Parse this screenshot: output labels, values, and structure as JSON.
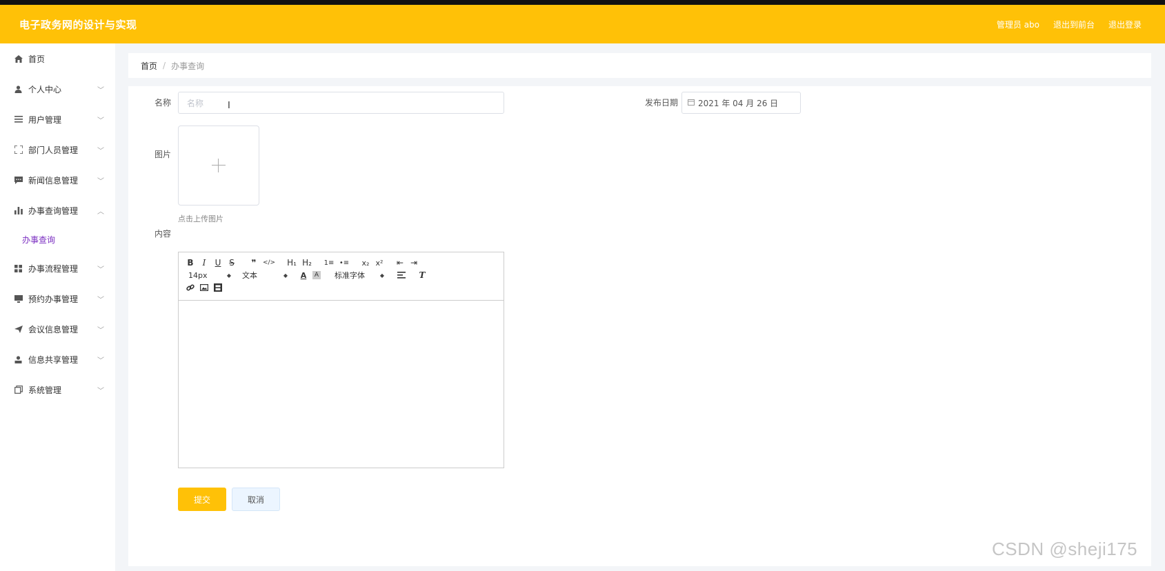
{
  "header": {
    "title": "电子政务网的设计与实现",
    "user_label": "管理员 abo",
    "back_to_front": "退出到前台",
    "logout": "退出登录",
    "bg_color": "#ffc107"
  },
  "sidebar": {
    "items": [
      {
        "label": "首页",
        "icon": "home-icon",
        "expandable": false
      },
      {
        "label": "个人中心",
        "icon": "user-icon",
        "expandable": true
      },
      {
        "label": "用户管理",
        "icon": "list-icon",
        "expandable": true
      },
      {
        "label": "部门人员管理",
        "icon": "expand-icon",
        "expandable": true
      },
      {
        "label": "新闻信息管理",
        "icon": "message-icon",
        "expandable": true
      },
      {
        "label": "办事查询管理",
        "icon": "bar-chart-icon",
        "expandable": true,
        "expanded": true
      },
      {
        "label": "办事流程管理",
        "icon": "grid-icon",
        "expandable": true
      },
      {
        "label": "预约办事管理",
        "icon": "monitor-icon",
        "expandable": true
      },
      {
        "label": "会议信息管理",
        "icon": "send-icon",
        "expandable": true
      },
      {
        "label": "信息共享管理",
        "icon": "person-icon",
        "expandable": true
      },
      {
        "label": "系统管理",
        "icon": "copy-icon",
        "expandable": true
      }
    ],
    "submenu": {
      "label": "办事查询",
      "color": "#7b2fc1"
    }
  },
  "breadcrumb": {
    "home": "首页",
    "separator": "/",
    "current": "办事查询"
  },
  "form": {
    "name_label": "名称",
    "name_placeholder": "名称",
    "date_label": "发布日期",
    "date_value": "2021 年 04 月 26 日",
    "image_label": "图片",
    "upload_tip": "点击上传图片",
    "content_label": "内容",
    "submit": "提交",
    "cancel": "取消"
  },
  "editor": {
    "size_select": "14px",
    "format_select": "文本",
    "font_select": "标准字体",
    "row1": [
      {
        "label": "B",
        "icon": "bold-icon"
      },
      {
        "label": "I",
        "icon": "italic-icon"
      },
      {
        "label": "U",
        "icon": "underline-icon"
      },
      {
        "label": "S",
        "icon": "strikethrough-icon"
      },
      {
        "label": "❞",
        "icon": "blockquote-icon"
      },
      {
        "label": "</>",
        "icon": "code-icon"
      },
      {
        "label": "H₁",
        "icon": "header1-icon"
      },
      {
        "label": "H₂",
        "icon": "header2-icon"
      },
      {
        "label": "1≡",
        "icon": "ordered-list-icon"
      },
      {
        "label": "•≡",
        "icon": "bullet-list-icon"
      },
      {
        "label": "x₂",
        "icon": "subscript-icon"
      },
      {
        "label": "x²",
        "icon": "superscript-icon"
      },
      {
        "label": "⇤",
        "icon": "outdent-icon"
      },
      {
        "label": "⇥",
        "icon": "indent-icon"
      }
    ]
  },
  "watermark": "CSDN @sheji175"
}
